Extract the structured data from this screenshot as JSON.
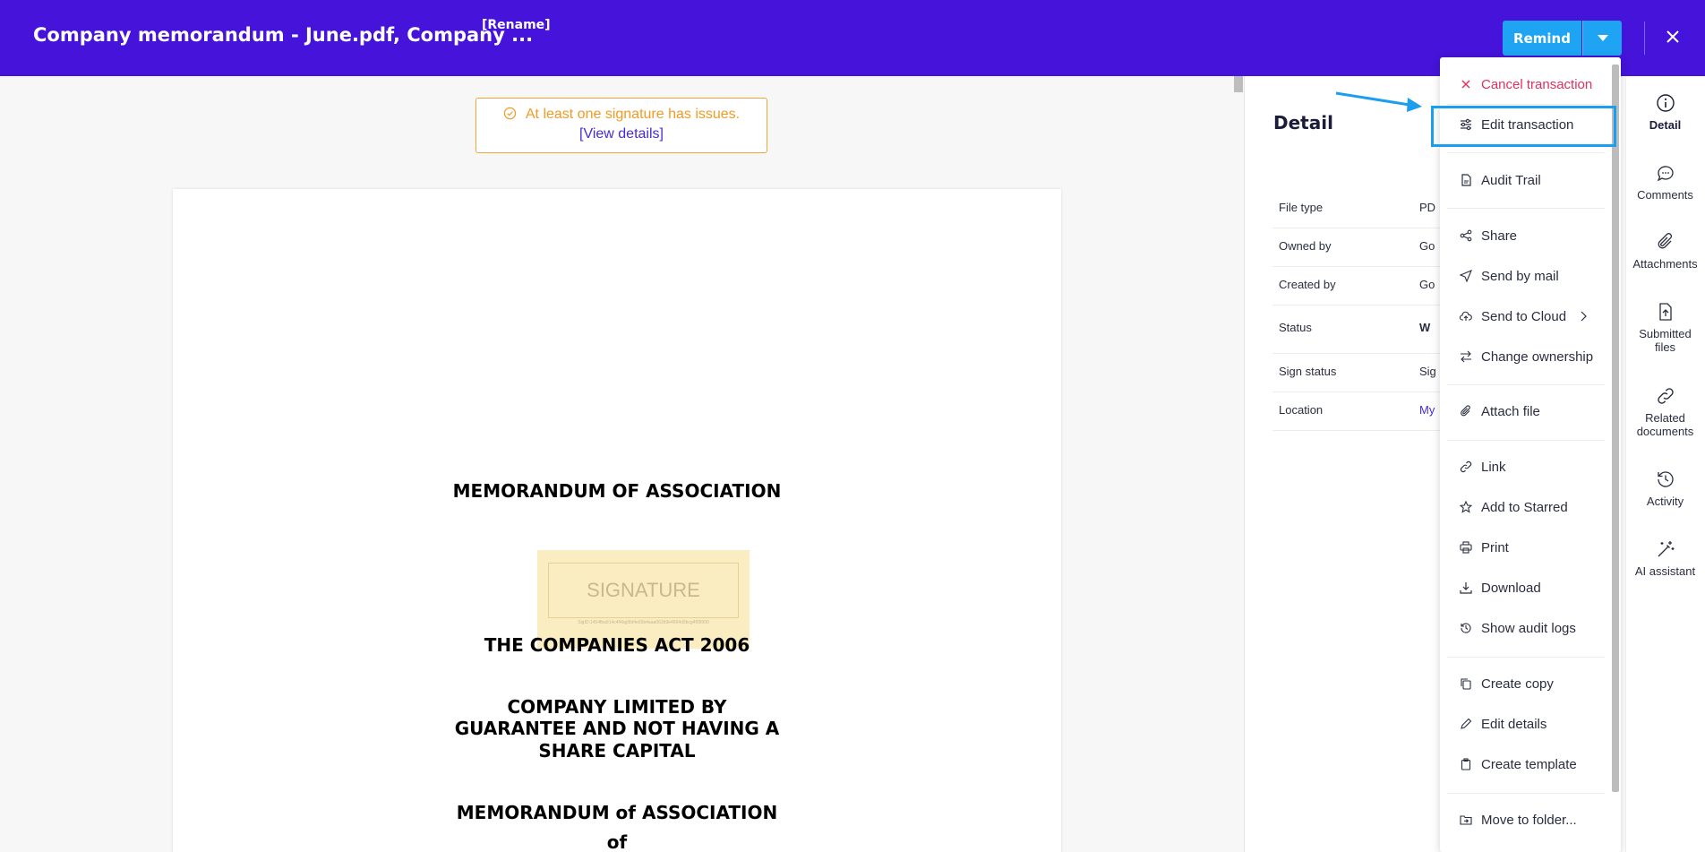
{
  "header": {
    "title": "Company memorandum - June.pdf, Company ...",
    "rename_label": "[Rename]",
    "remind_label": "Remind"
  },
  "warning": {
    "message": "At least one signature has issues.",
    "link": "[View details]"
  },
  "document": {
    "heading1": "MEMORANDUM OF ASSOCIATION",
    "signature_label": "SIGNATURE",
    "signature_id": "SigID:1454fba914c4f4bg9fd4e65b4aaa062b9e4694d9bcg4f05500",
    "heading2": "THE COMPANIES ACT 2006",
    "heading3_lines": [
      "COMPANY LIMITED BY",
      "GUARANTEE AND NOT HAVING A",
      "SHARE CAPITAL"
    ],
    "heading4": "MEMORANDUM of ASSOCIATION",
    "heading5": "of"
  },
  "detail": {
    "title": "Detail",
    "rows": [
      {
        "key": "File type",
        "value": "PD"
      },
      {
        "key": "Owned by",
        "value": "Go"
      },
      {
        "key": "Created by",
        "value": "Go"
      },
      {
        "key": "Status",
        "value": "W"
      },
      {
        "key": "Sign status",
        "value": "Sig"
      },
      {
        "key": "Location",
        "value": "My"
      }
    ]
  },
  "menu": {
    "items": [
      {
        "label": "Cancel transaction",
        "icon": "close-icon"
      },
      {
        "label": "Edit transaction",
        "icon": "sliders-icon"
      },
      {
        "label": "Audit Trail",
        "icon": "document-icon"
      },
      {
        "label": "Share",
        "icon": "share-icon"
      },
      {
        "label": "Send by mail",
        "icon": "send-icon"
      },
      {
        "label": "Send to Cloud",
        "icon": "cloud-upload-icon"
      },
      {
        "label": "Change ownership",
        "icon": "swap-icon"
      },
      {
        "label": "Attach file",
        "icon": "paperclip-icon"
      },
      {
        "label": "Link",
        "icon": "link-icon"
      },
      {
        "label": "Add to Starred",
        "icon": "star-icon"
      },
      {
        "label": "Print",
        "icon": "printer-icon"
      },
      {
        "label": "Download",
        "icon": "download-icon"
      },
      {
        "label": "Show audit logs",
        "icon": "history-icon"
      },
      {
        "label": "Create copy",
        "icon": "copy-icon"
      },
      {
        "label": "Edit details",
        "icon": "pencil-icon"
      },
      {
        "label": "Create template",
        "icon": "clipboard-icon"
      },
      {
        "label": "Move to folder...",
        "icon": "folder-move-icon"
      }
    ]
  },
  "rail": {
    "items": [
      {
        "label": "Detail",
        "icon": "info-icon"
      },
      {
        "label": "Comments",
        "icon": "comment-icon"
      },
      {
        "label": "Attachments",
        "icon": "paperclip-icon"
      },
      {
        "label": "Submitted files",
        "icon": "file-upload-icon"
      },
      {
        "label": "Related documents",
        "icon": "link-icon"
      },
      {
        "label": "Activity",
        "icon": "history-icon"
      },
      {
        "label": "AI assistant",
        "icon": "magic-wand-icon"
      }
    ]
  },
  "colors": {
    "header_bg": "#4513d9",
    "accent": "#1fa4f3",
    "warning": "#f39a25",
    "danger": "#e0305c",
    "link": "#4a2bd3"
  }
}
